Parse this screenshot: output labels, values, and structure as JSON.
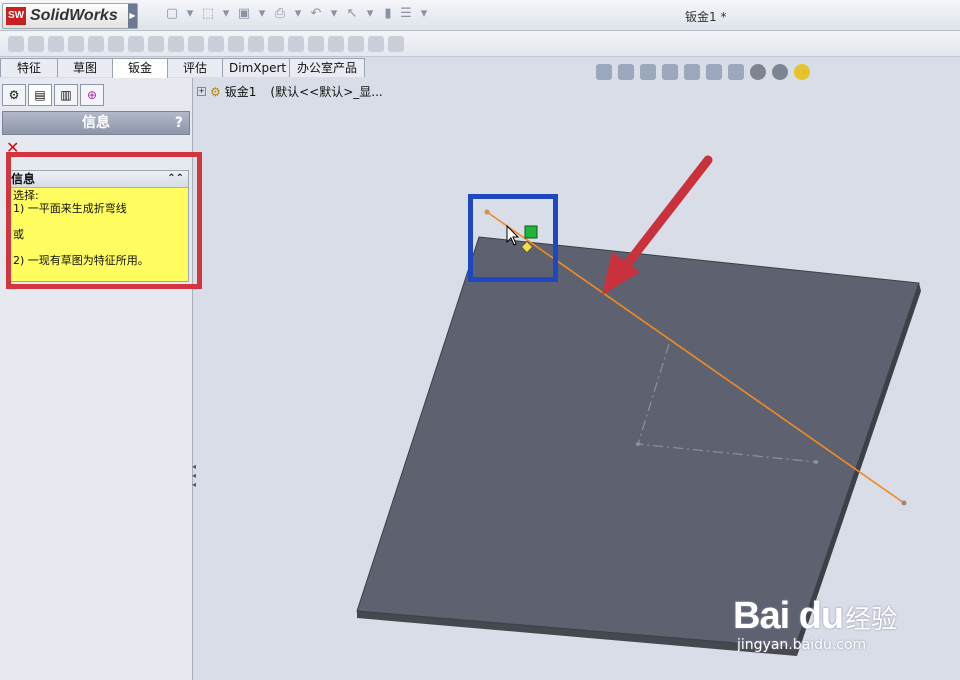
{
  "app": {
    "logo_badge": "SW",
    "logo_name": "SolidWorks",
    "document_title": "钣金1 *"
  },
  "command_tabs": [
    {
      "label": "特征",
      "active": false
    },
    {
      "label": "草图",
      "active": false
    },
    {
      "label": "钣金",
      "active": true
    },
    {
      "label": "评估",
      "active": false
    },
    {
      "label": "DimXpert",
      "active": false
    },
    {
      "label": "办公室产品",
      "active": false
    }
  ],
  "property_manager": {
    "title": "信息",
    "help": "?",
    "close": "✕",
    "group_title": "信息",
    "message_lines": [
      "选择:",
      "1) 一平面来生成折弯线",
      "",
      "或",
      "",
      "2) 一现有草图为特征所用。"
    ]
  },
  "feature_tree": {
    "expander": "+",
    "root_label": "钣金1",
    "config_label": "(默认<<默认>_显..."
  },
  "watermark": {
    "brand": "Bai du",
    "suffix": "经验",
    "url": "jingyan.baidu.com"
  },
  "colors": {
    "accent_red": "#d2353e",
    "highlight_blue": "#1f48c0",
    "sketch_line": "#f08a24",
    "plate": "#5e6270",
    "info_yellow": "#fffd60"
  }
}
